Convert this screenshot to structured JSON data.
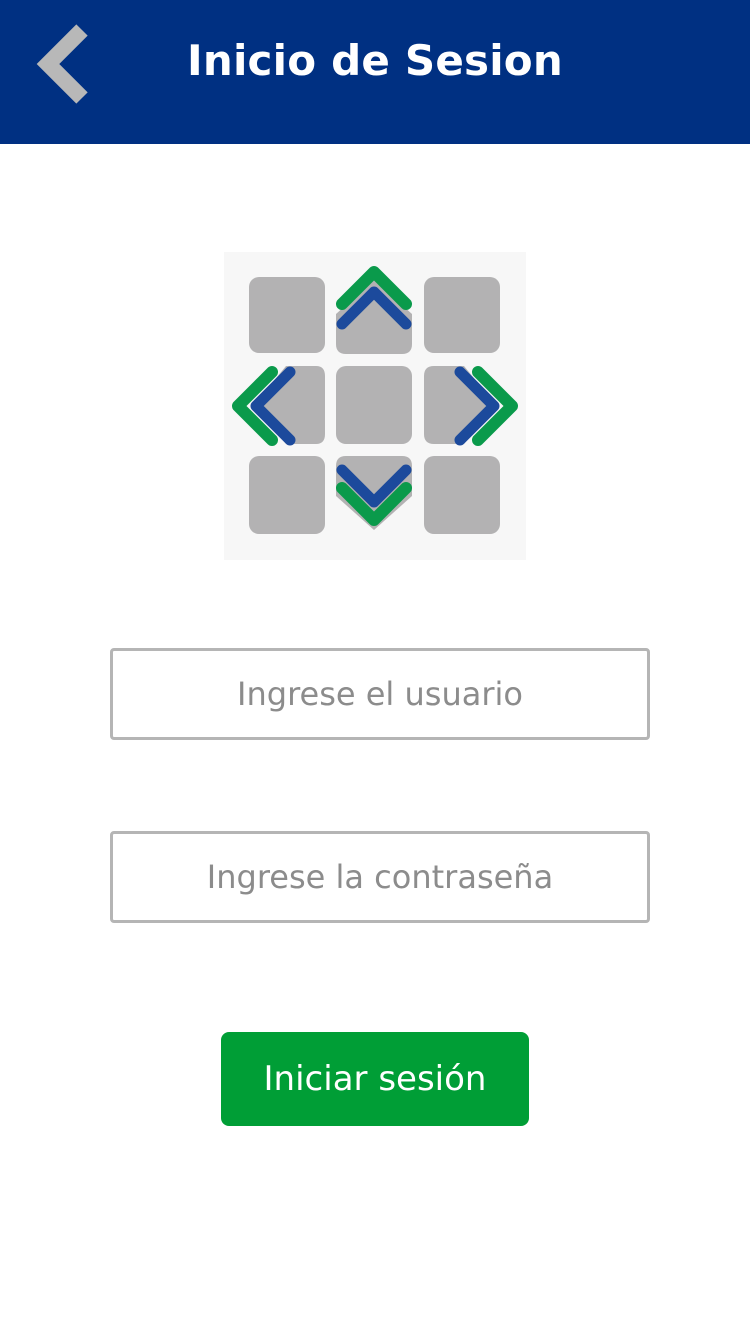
{
  "header": {
    "title": "Inicio de Sesion",
    "back_icon": "chevron-left-icon",
    "background_color": "#003082"
  },
  "logo": {
    "icon": "directional-arrows-logo",
    "colors": {
      "tile": "#b3b2b3",
      "arrow_outer": "#0a9a4b",
      "arrow_inner": "#1c4a9c"
    }
  },
  "form": {
    "username": {
      "placeholder": "Ingrese el usuario",
      "value": ""
    },
    "password": {
      "placeholder": "Ingrese la contraseña",
      "value": ""
    },
    "submit_label": "Iniciar sesión",
    "submit_color": "#009e36",
    "field_border_color": "#b5b5b5"
  }
}
